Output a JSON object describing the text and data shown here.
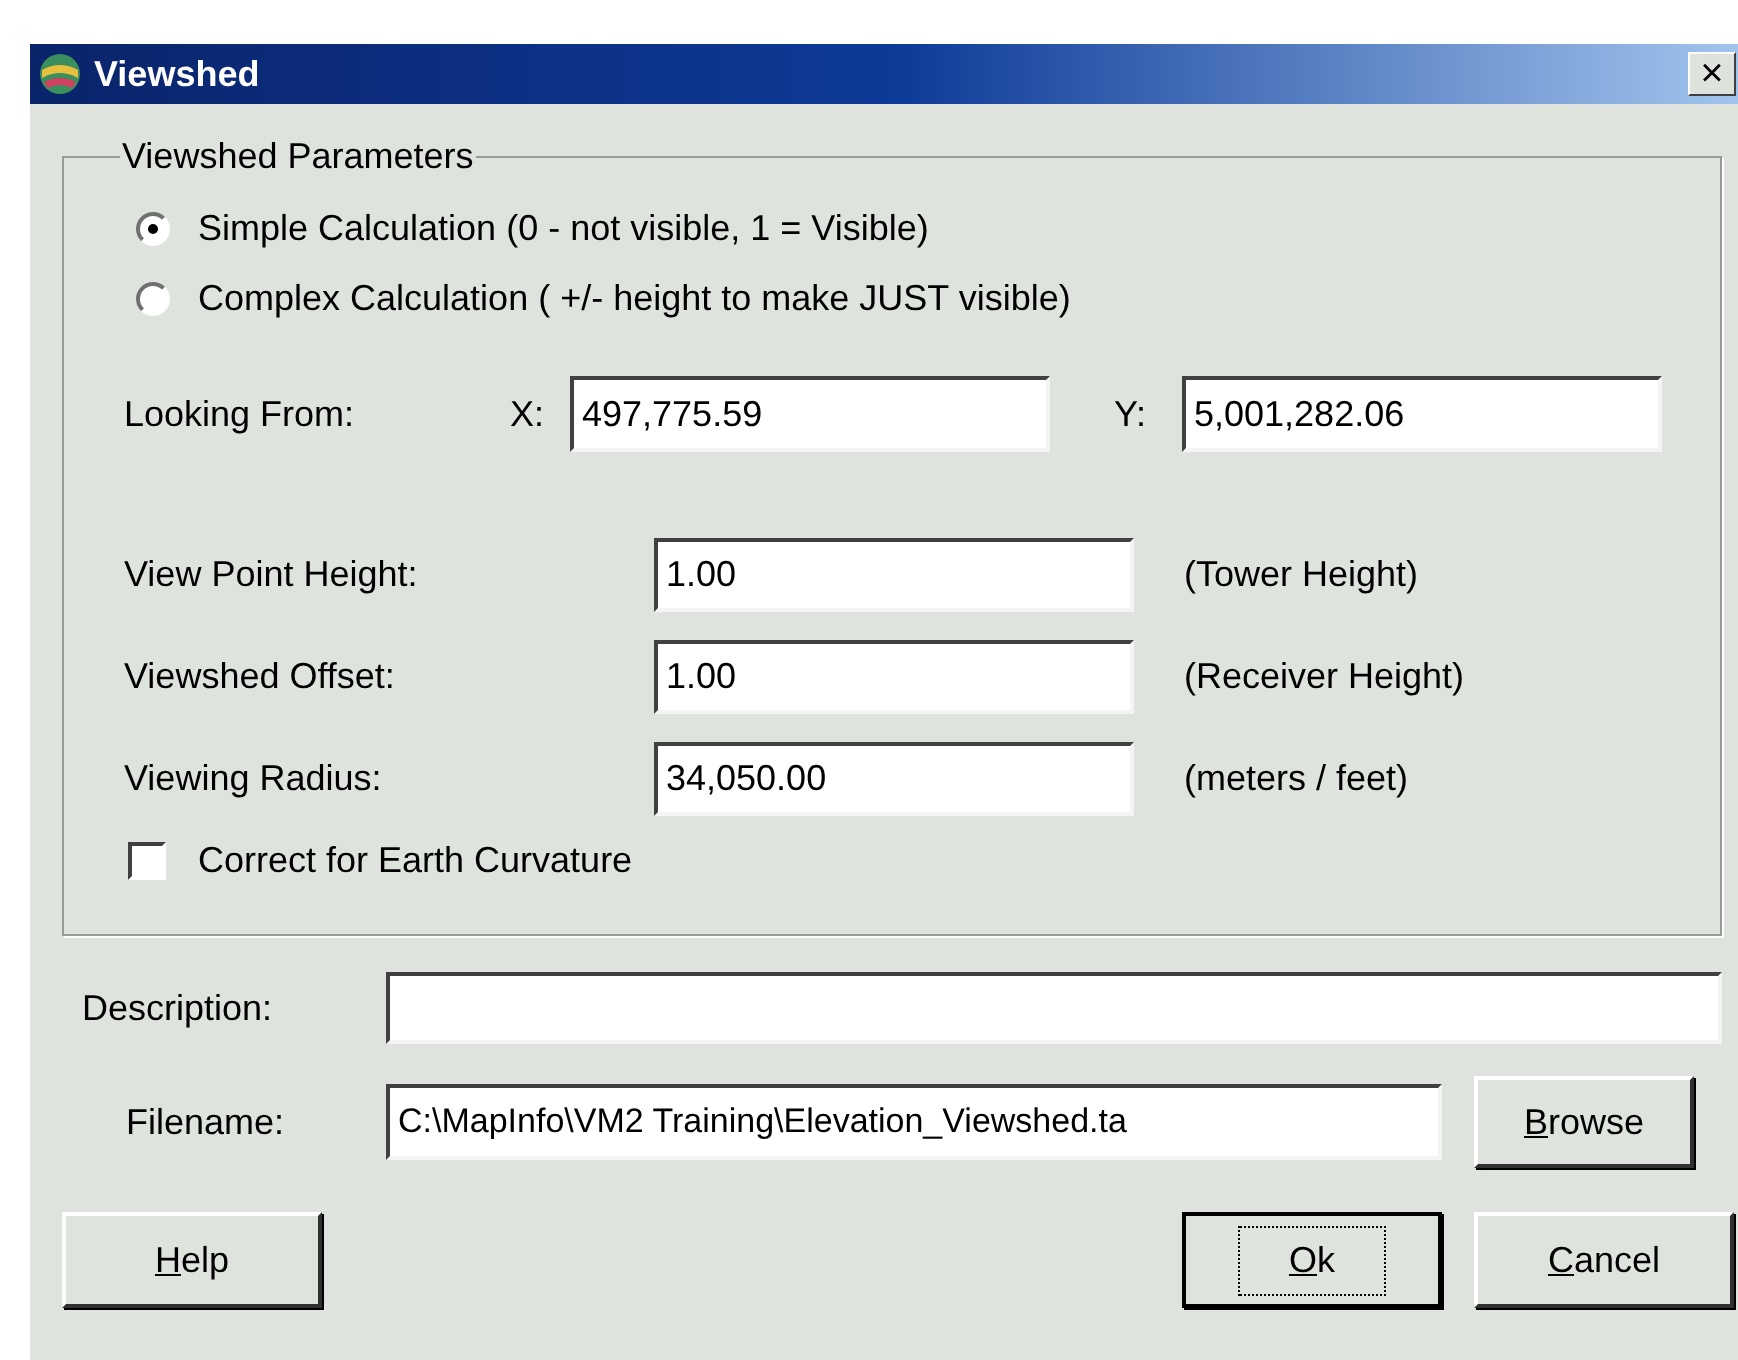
{
  "window": {
    "title": "Viewshed",
    "close": "×"
  },
  "parameters": {
    "legend": "Viewshed Parameters",
    "calculation": [
      {
        "label": "Simple Calculation (0 - not visible, 1 = Visible)",
        "selected": true
      },
      {
        "label": "Complex Calculation ( +/- height to make JUST visible)",
        "selected": false
      }
    ],
    "looking_from": {
      "label": "Looking From:",
      "x_label": "X:",
      "x_value": "497,775.59",
      "y_label": "Y:",
      "y_value": "5,001,282.06"
    },
    "fields": [
      {
        "label": "View Point Height:",
        "value": "1.00",
        "note": "(Tower Height)"
      },
      {
        "label": "Viewshed Offset:",
        "value": "1.00",
        "note": "(Receiver Height)"
      },
      {
        "label": "Viewing Radius:",
        "value": "34,050.00",
        "note": "(meters / feet)"
      }
    ],
    "earth_curvature": {
      "label": "Correct for Earth Curvature",
      "checked": false
    }
  },
  "description": {
    "label": "Description:"
  },
  "filename": {
    "label": "Filename:",
    "value": "C:\\MapInfo\\VM2 Training\\Elevation_Viewshed.ta",
    "browse": "Browse"
  },
  "buttons": {
    "help": "Help",
    "ok": "Ok",
    "cancel": "Cancel"
  }
}
